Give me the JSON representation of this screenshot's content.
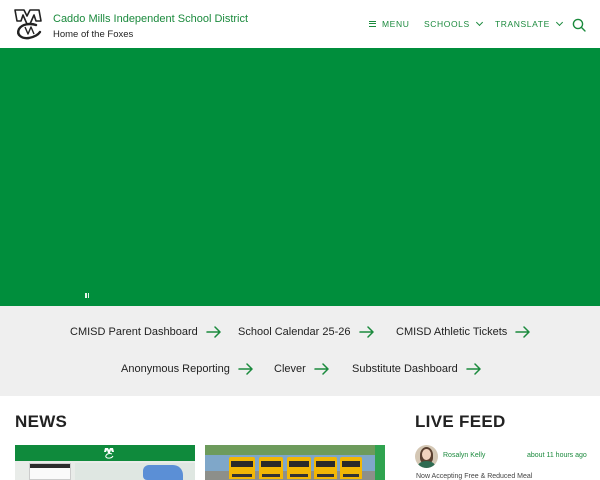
{
  "header": {
    "district_name": "Caddo Mills Independent School District",
    "tagline": "Home of the Foxes",
    "nav": {
      "menu_label": "MENU",
      "schools_label": "SCHOOLS",
      "translate_label": "TRANSLATE"
    },
    "icons": {
      "logo": "cm-logo-icon",
      "menu": "hamburger-icon",
      "dropdown": "chevron-down-icon",
      "search": "search-icon"
    }
  },
  "hero": {
    "background_color": "#008e3c",
    "pause_icon": "pause-icon"
  },
  "quick_links": [
    {
      "label": "CMISD Parent Dashboard"
    },
    {
      "label": "School Calendar 25-26"
    },
    {
      "label": "CMISD Athletic Tickets"
    },
    {
      "label": "Anonymous Reporting"
    },
    {
      "label": "Clever"
    },
    {
      "label": "Substitute Dashboard"
    }
  ],
  "news": {
    "title": "NEWS"
  },
  "live_feed": {
    "title": "LIVE FEED",
    "post": {
      "author": "Rosalyn Kelly",
      "time": "about 11 hours ago",
      "text": "Now Accepting Free & Reduced Meal"
    }
  },
  "colors": {
    "accent": "#1b8a3d",
    "hero": "#008e3c",
    "quick_links_bg": "#efefef"
  }
}
